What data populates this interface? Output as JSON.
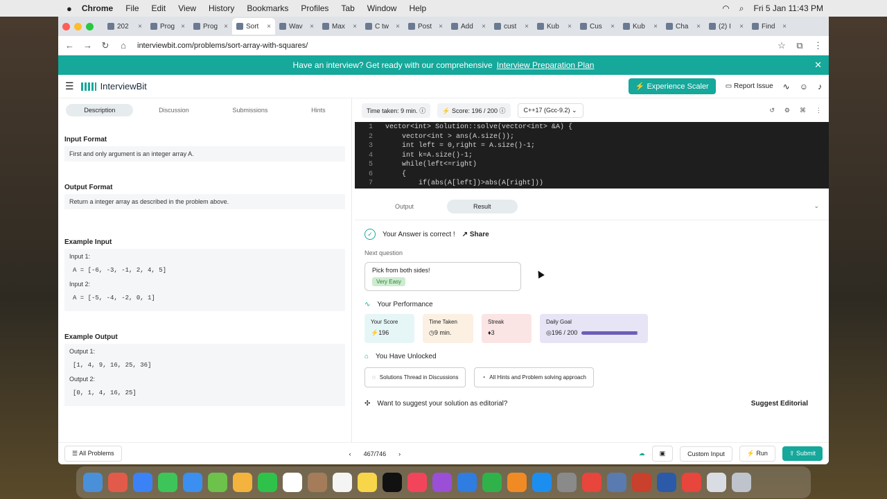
{
  "menubar": {
    "app": "Chrome",
    "items": [
      "File",
      "Edit",
      "View",
      "History",
      "Bookmarks",
      "Profiles",
      "Tab",
      "Window",
      "Help"
    ],
    "clock": "Fri 5 Jan  11:43 PM"
  },
  "tabs": [
    "202",
    "Prog",
    "Prog",
    "Sort",
    "Wav",
    "Max",
    "C tw",
    "Post",
    "Add",
    "cust",
    "Kub",
    "Cus",
    "Kub",
    "Cha",
    "(2) I",
    "Find"
  ],
  "address": {
    "url": "interviewbit.com/problems/sort-array-with-squares/"
  },
  "banner": {
    "text": "Have an interview? Get ready with our comprehensive",
    "link": "Interview Preparation Plan"
  },
  "header": {
    "logo": "InterviewBit",
    "experience": "Experience Scaler",
    "report": "Report Issue"
  },
  "left": {
    "tabs": [
      "Description",
      "Discussion",
      "Submissions",
      "Hints"
    ],
    "input_format_title": "Input Format",
    "input_format_text": "First and only argument is an integer array A.",
    "output_format_title": "Output Format",
    "output_format_text": "Return a integer array as described in the problem above.",
    "example_input_title": "Example Input",
    "input1_label": "Input 1:",
    "input1_value": "A = [-6, -3, -1, 2, 4, 5]",
    "input2_label": "Input 2:",
    "input2_value": "A = [-5, -4, -2, 0, 1]",
    "example_output_title": "Example Output",
    "output1_label": "Output 1:",
    "output1_value": "[1, 4, 9, 16, 25, 36]",
    "output2_label": "Output 2:",
    "output2_value": "[0, 1, 4, 16, 25]"
  },
  "toolbar": {
    "time": "Time taken: 9 min.",
    "score": "Score: 196 / 200",
    "lang": "C++17 (Gcc-9.2)"
  },
  "code": [
    {
      "n": "1",
      "t": "vector<int> Solution::solve(vector<int> &A) {"
    },
    {
      "n": "2",
      "t": "    vector<int > ans(A.size());"
    },
    {
      "n": "3",
      "t": "    int left = 0,right = A.size()-1;"
    },
    {
      "n": "4",
      "t": "    int k=A.size()-1;"
    },
    {
      "n": "5",
      "t": "    while(left<=right)"
    },
    {
      "n": "6",
      "t": "    {"
    },
    {
      "n": "7",
      "t": "        if(abs(A[left])>abs(A[right]))"
    }
  ],
  "result": {
    "tabs": [
      "Output",
      "Result"
    ],
    "correct": "Your Answer is correct !",
    "share": "Share",
    "next_label": "Next question",
    "next_title": "Pick from both sides!",
    "next_level": "Very Easy",
    "perf_title": "Your Performance",
    "score_label": "Your Score",
    "score_value": "196",
    "time_label": "Time Taken",
    "time_value": "9 min.",
    "streak_label": "Streak",
    "streak_value": "3",
    "goal_label": "Daily Goal",
    "goal_value": "196 / 200",
    "goal_progress": 0.98,
    "unlock_title": "You Have Unlocked",
    "unlock1": "Solutions Thread in Discussions",
    "unlock2": "All Hints and Problem solving approach",
    "suggest_q": "Want to suggest your solution as editorial?",
    "suggest_btn": "Suggest Editorial"
  },
  "footer": {
    "all": "All Problems",
    "page": "467/746",
    "custom": "Custom Input",
    "run": "Run",
    "submit": "Submit"
  },
  "colors": {
    "accent": "#15a89b"
  }
}
